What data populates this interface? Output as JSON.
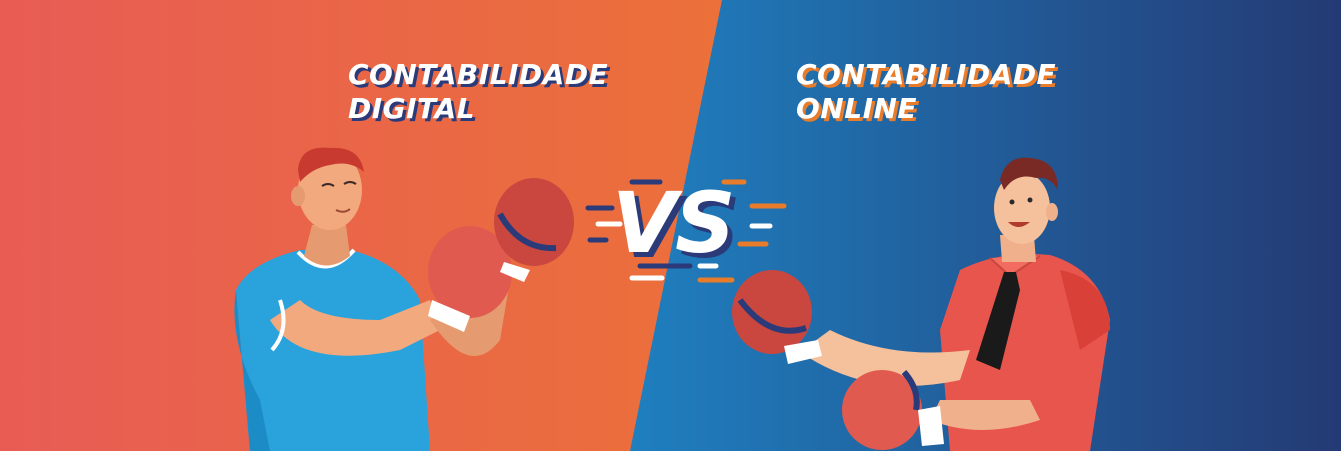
{
  "banner": {
    "left_title_line1": "CONTABILIDADE",
    "left_title_line2": "DIGITAL",
    "right_title_line1": "CONTABILIDADE",
    "right_title_line2": "ONLINE",
    "versus": "VS"
  },
  "colors": {
    "left_gradient_start": "#e85c55",
    "left_gradient_end": "#ee8122",
    "right_gradient_start": "#1f7fbf",
    "right_gradient_end": "#243a74",
    "glove": "#e05a4f",
    "shirt_left": "#2aa3dc",
    "shirt_right": "#e8554c",
    "tie": "#1a1a1a"
  },
  "icons": [
    "left-fighter-illustration",
    "right-fighter-illustration",
    "speed-lines-icon"
  ]
}
